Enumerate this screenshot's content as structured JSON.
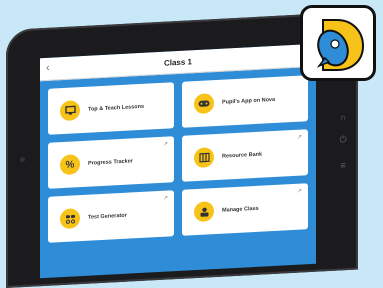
{
  "header": {
    "title": "Class 1"
  },
  "tiles": [
    {
      "label": "Top & Teach Lessons",
      "icon": "monitor-icon",
      "external": false
    },
    {
      "label": "Pupil's App on Nova",
      "icon": "gamepad-icon",
      "external": false
    },
    {
      "label": "Progress Tracker",
      "icon": "percent-icon",
      "external": true
    },
    {
      "label": "Resource Bank",
      "icon": "book-icon",
      "external": true
    },
    {
      "label": "Test Generator",
      "icon": "generator-icon",
      "external": true
    },
    {
      "label": "Manage Class",
      "icon": "person-icon",
      "external": true
    }
  ],
  "colors": {
    "background": "#c9e8f7",
    "app_blue": "#2e8dd6",
    "tile_accent": "#f8c318"
  }
}
